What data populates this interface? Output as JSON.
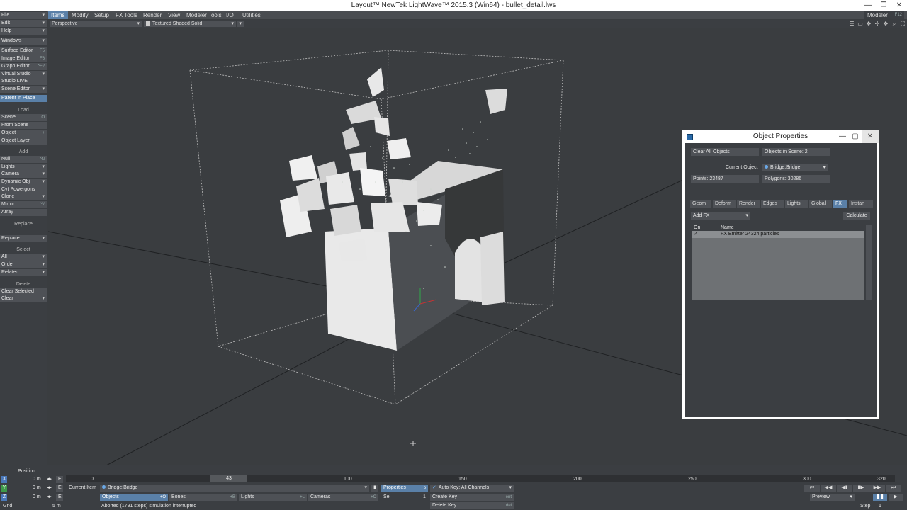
{
  "window": {
    "title": "Layout™ NewTek LightWave™ 2015.3 (Win64) - bullet_detail.lws",
    "controls": [
      "—",
      "❐",
      "✕"
    ]
  },
  "tabs": [
    "Items",
    "Modify",
    "Setup",
    "FX Tools",
    "Render",
    "View",
    "Modeler Tools",
    "I/O",
    "Utilities"
  ],
  "modeler_button": "Modeler",
  "modeler_shortcut": "F12",
  "left": {
    "file": "File",
    "edit": "Edit",
    "help": "Help",
    "windows": "Windows",
    "surface_editor": "Surface Editor",
    "surface_sc": "F5",
    "image_editor": "Image Editor",
    "image_sc": "F6",
    "graph_editor": "Graph Editor",
    "graph_sc": "^F2",
    "virtual_studio": "Virtual Studio",
    "studio_live": "Studio LIVE",
    "scene_editor": "Scene Editor",
    "parent_in_place": "Parent in Place",
    "load_header": "Load",
    "scene": "Scene",
    "scene_sc": "O",
    "from_scene": "From Scene",
    "object": "Object",
    "object_sc": "+",
    "object_layer": "Object Layer",
    "add_header": "Add",
    "null": "Null",
    "null_sc": "^N",
    "lights": "Lights",
    "camera": "Camera",
    "dynamic_obj": "Dynamic Obj",
    "cvt_powergons": "Cvt Powergons",
    "clone": "Clone",
    "mirror": "Mirror",
    "mirror_sc": "^V",
    "array": "Array",
    "replace_header": "Replace",
    "replace": "Replace",
    "select_header": "Select",
    "all": "All",
    "order": "Order",
    "related": "Related",
    "delete_header": "Delete",
    "clear_selected": "Clear Selected",
    "clear": "Clear"
  },
  "viewport": {
    "view": "Perspective",
    "shading": "Textured Shaded Solid"
  },
  "panel": {
    "title": "Object Properties",
    "clear_all": "Clear All Objects",
    "objects_in_scene": "Objects in Scene: 2",
    "current_object_label": "Current Object",
    "current_object": "Bridge:Bridge",
    "points": "Points: 23487",
    "polygons": "Polygons: 30286",
    "tabs": [
      "Geom",
      "Deform",
      "Render",
      "Edges",
      "Lights",
      "Global",
      "FX",
      "Instan"
    ],
    "add_fx": "Add FX",
    "calculate": "Calculate",
    "col_on": "On",
    "col_name": "Name",
    "fx_item_check": "✓",
    "fx_item": "FX Emitter 24324 particles"
  },
  "timeline": {
    "position_label": "Position",
    "ticks": [
      "0",
      "100",
      "150",
      "200",
      "250",
      "300",
      "320"
    ],
    "handle": "43",
    "x_label": "X",
    "y_label": "Y",
    "z_label": "Z",
    "x_val": "0 m",
    "y_val": "0 m",
    "z_val": "0 m",
    "grid_label": "Grid",
    "grid_val": "5 m",
    "e_label": "E",
    "current_item_label": "Current Item",
    "current_item": "Bridge:Bridge",
    "objects": "Objects",
    "objects_sc": "+O",
    "bones": "Bones",
    "bones_sc": "+B",
    "lights": "Lights",
    "lights_sc": "+L",
    "cameras": "Cameras",
    "cameras_sc": "+C",
    "properties": "Properties",
    "properties_sc": "p",
    "sel_label": "Sel",
    "sel_val": "1",
    "auto_key": "Auto Key: All Channels",
    "create_key": "Create Key",
    "create_key_sc": "ent",
    "delete_key": "Delete Key",
    "delete_key_sc": "del",
    "status": "Aborted (1791 steps) simulation interrupted",
    "preview": "Preview",
    "step_label": "Step",
    "step_val": "1",
    "transport": [
      "⏮",
      "◀◀",
      "◀▮",
      "▮▶",
      "▶▶",
      "⏭"
    ]
  }
}
